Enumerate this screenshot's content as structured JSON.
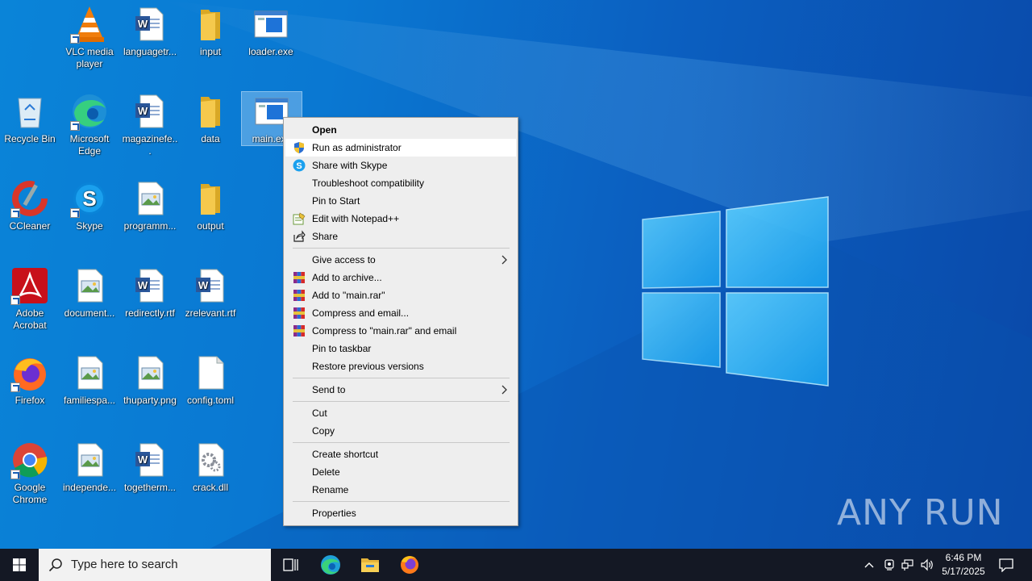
{
  "desktop": {
    "icons": [
      {
        "label": "VLC media player",
        "type": "vlc"
      },
      {
        "label": "languagetr...",
        "type": "word"
      },
      {
        "label": "input",
        "type": "folder"
      },
      {
        "label": "loader.exe",
        "type": "exe"
      },
      {
        "label": "Recycle Bin",
        "type": "recycle"
      },
      {
        "label": "Microsoft Edge",
        "type": "edge"
      },
      {
        "label": "magazinefe...",
        "type": "word"
      },
      {
        "label": "data",
        "type": "folder"
      },
      {
        "label": "main.exe",
        "type": "exe",
        "selected": true
      },
      {
        "label": "CCleaner",
        "type": "ccleaner"
      },
      {
        "label": "Skype",
        "type": "skype"
      },
      {
        "label": "programm...",
        "type": "image"
      },
      {
        "label": "output",
        "type": "folder"
      },
      {
        "label": "Adobe Acrobat",
        "type": "acrobat"
      },
      {
        "label": "document...",
        "type": "image"
      },
      {
        "label": "redirectly.rtf",
        "type": "word"
      },
      {
        "label": "zrelevant.rtf",
        "type": "word"
      },
      {
        "label": "Firefox",
        "type": "firefox"
      },
      {
        "label": "familiespa...",
        "type": "image"
      },
      {
        "label": "thuparty.png",
        "type": "image"
      },
      {
        "label": "config.toml",
        "type": "blank"
      },
      {
        "label": "Google Chrome",
        "type": "chrome"
      },
      {
        "label": "independe...",
        "type": "image"
      },
      {
        "label": "togetherm...",
        "type": "word"
      },
      {
        "label": "crack.dll",
        "type": "dll"
      }
    ]
  },
  "context_menu": {
    "items": [
      {
        "label": "Open",
        "bold": true
      },
      {
        "label": "Run as administrator",
        "icon": "shield-icon",
        "highlighted": true
      },
      {
        "label": "Share with Skype",
        "icon": "skype-icon"
      },
      {
        "label": "Troubleshoot compatibility"
      },
      {
        "label": "Pin to Start"
      },
      {
        "label": "Edit with Notepad++",
        "icon": "notepadpp-icon"
      },
      {
        "label": "Share",
        "icon": "share-icon"
      },
      {
        "separator": true
      },
      {
        "label": "Give access to",
        "submenu": true
      },
      {
        "label": "Add to archive...",
        "icon": "winrar-icon"
      },
      {
        "label": "Add to \"main.rar\"",
        "icon": "winrar-icon"
      },
      {
        "label": "Compress and email...",
        "icon": "winrar-icon"
      },
      {
        "label": "Compress to \"main.rar\" and email",
        "icon": "winrar-icon"
      },
      {
        "label": "Pin to taskbar"
      },
      {
        "label": "Restore previous versions"
      },
      {
        "separator": true
      },
      {
        "label": "Send to",
        "submenu": true
      },
      {
        "separator": true
      },
      {
        "label": "Cut"
      },
      {
        "label": "Copy"
      },
      {
        "separator": true
      },
      {
        "label": "Create shortcut"
      },
      {
        "label": "Delete"
      },
      {
        "label": "Rename"
      },
      {
        "separator": true
      },
      {
        "label": "Properties"
      }
    ]
  },
  "taskbar": {
    "search_placeholder": "Type here to search",
    "clock_time": "6:46 PM",
    "clock_date": "5/17/2025",
    "pinned": [
      "task-view-icon",
      "edge-icon",
      "file-explorer-icon",
      "firefox-icon"
    ]
  },
  "watermark": "ANY RUN",
  "colors": {
    "desktop_blue": "#0a78d2",
    "menu_bg": "#eeeeee",
    "taskbar_bg": "#141824"
  }
}
